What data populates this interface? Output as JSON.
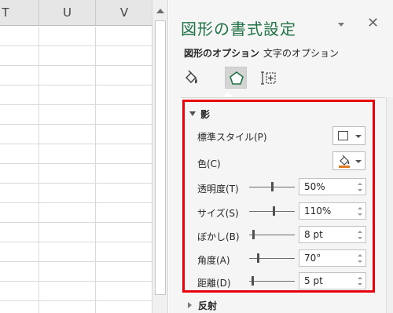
{
  "sheet": {
    "columns": [
      "T",
      "U",
      "V"
    ]
  },
  "pane": {
    "title": "図形の書式設定",
    "close_glyph": "✕",
    "tabs": [
      {
        "label": "図形のオプション",
        "active": true
      },
      {
        "label": "文字のオプション",
        "active": false
      }
    ],
    "icons": [
      "fill-line-icon",
      "effects-icon",
      "size-properties-icon"
    ]
  },
  "shadow": {
    "title": "影",
    "preset_label": "標準スタイル(P)",
    "color_label": "色(C)",
    "color_swatch": "#e07a1f",
    "highlight_color": "#e8000b",
    "rows": [
      {
        "key": "transparency",
        "label": "透明度(T)",
        "value": "50%",
        "level": 0.5
      },
      {
        "key": "size",
        "label": "サイズ(S)",
        "value": "110%",
        "level": 0.55
      },
      {
        "key": "blur",
        "label": "ぼかし(B)",
        "value": "8 pt",
        "level": 0.08
      },
      {
        "key": "angle",
        "label": "角度(A)",
        "value": "70°",
        "level": 0.19
      },
      {
        "key": "distance",
        "label": "距離(D)",
        "value": "5 pt",
        "level": 0.05
      }
    ]
  },
  "next_section": {
    "title": "反射"
  },
  "accent": "#217346"
}
